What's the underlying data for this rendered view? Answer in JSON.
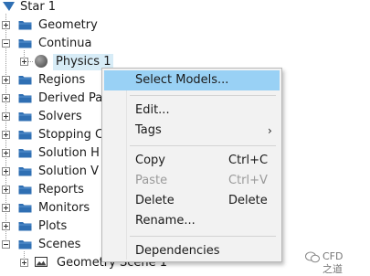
{
  "tree": {
    "root": "Star 1",
    "items": [
      {
        "label": "Geometry"
      },
      {
        "label": "Continua"
      },
      {
        "label": "Physics 1"
      },
      {
        "label": "Regions"
      },
      {
        "label": "Derived Pa"
      },
      {
        "label": "Solvers"
      },
      {
        "label": "Stopping C"
      },
      {
        "label": "Solution H"
      },
      {
        "label": "Solution V"
      },
      {
        "label": "Reports"
      },
      {
        "label": "Monitors"
      },
      {
        "label": "Plots"
      },
      {
        "label": "Scenes"
      },
      {
        "label": "Geometry Scene 1"
      }
    ]
  },
  "context_menu": {
    "items": [
      {
        "label": "Select Models...",
        "shortcut": "",
        "state": "highlighted"
      },
      {
        "label": "Edit...",
        "shortcut": ""
      },
      {
        "label": "Tags",
        "shortcut": "",
        "arrow": "›"
      },
      {
        "label": "Copy",
        "shortcut": "Ctrl+C"
      },
      {
        "label": "Paste",
        "shortcut": "Ctrl+V",
        "state": "disabled"
      },
      {
        "label": "Delete",
        "shortcut": "Delete"
      },
      {
        "label": "Rename...",
        "shortcut": ""
      },
      {
        "label": "Dependencies",
        "shortcut": ""
      }
    ]
  },
  "watermark": {
    "text": "CFD之道"
  },
  "colors": {
    "folder": "#2f6fb3",
    "menu_highlight": "#99d1f5",
    "selection": "#d7ecf7",
    "menu_bg": "#f2f2f2"
  }
}
